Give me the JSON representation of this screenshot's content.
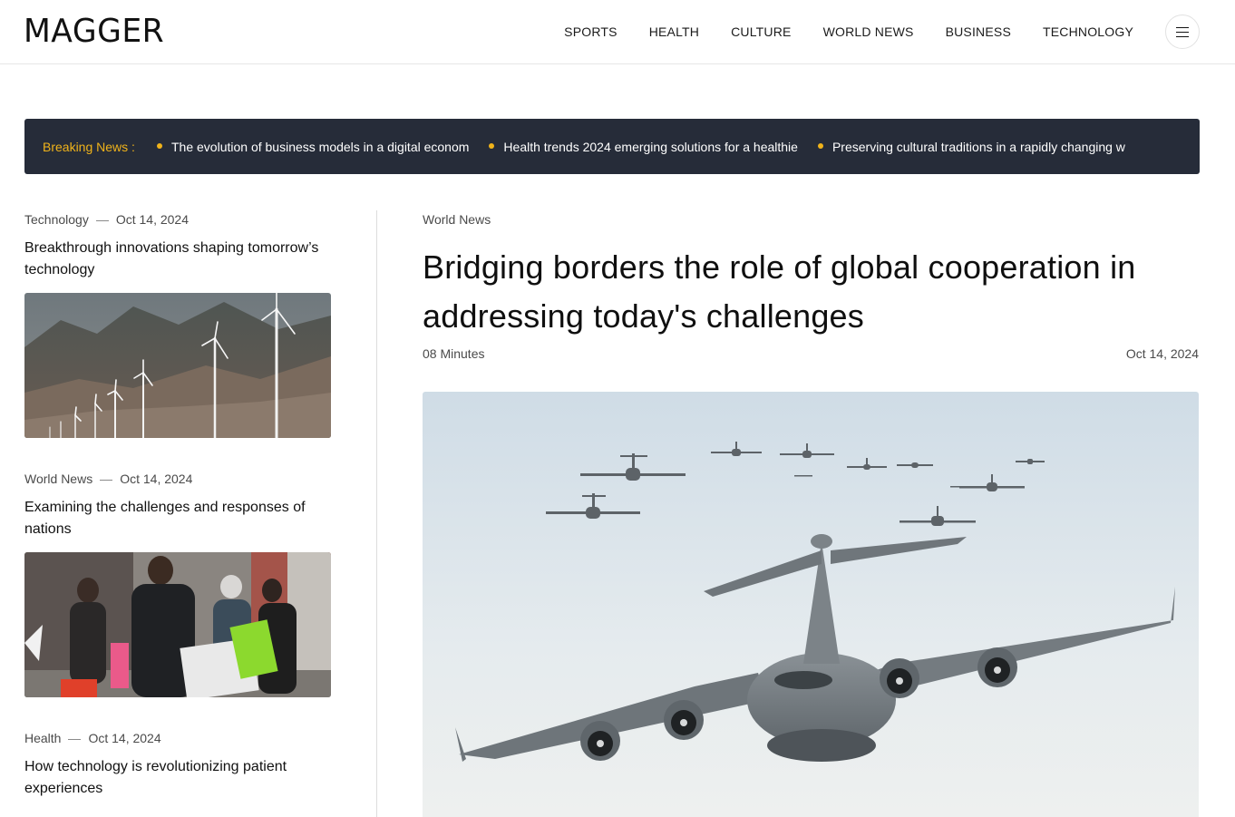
{
  "header": {
    "logo": "MAGGER",
    "nav": [
      "SPORTS",
      "HEALTH",
      "CULTURE",
      "WORLD NEWS",
      "BUSINESS",
      "TECHNOLOGY"
    ],
    "menu_icon": "hamburger-menu-icon"
  },
  "breaking": {
    "label": "Breaking News :",
    "accent_color": "#f0b31a",
    "background": "#262c39",
    "items": [
      "The evolution of business models in a digital econom",
      "Health trends 2024 emerging solutions for a healthie",
      "Preserving cultural traditions in a rapidly changing w"
    ]
  },
  "sidebar": {
    "articles": [
      {
        "category": "Technology",
        "date": "Oct 14, 2024",
        "title": "Breakthrough innovations shaping tomorrow’s technology",
        "image": "wind-turbines-mountain-photo"
      },
      {
        "category": "World News",
        "date": "Oct 14, 2024",
        "title": "Examining the challenges and responses of nations",
        "image": "protest-crowd-photo"
      },
      {
        "category": "Health",
        "date": "Oct 14, 2024",
        "title": "How technology is revolutionizing patient experiences",
        "image": "health-photo"
      }
    ]
  },
  "feature": {
    "category": "World News",
    "title": "Bridging borders the role of global cooperation in addressing today's challenges",
    "read_time": "08 Minutes",
    "date": "Oct 14, 2024",
    "image": "military-cargo-planes-formation-photo"
  }
}
